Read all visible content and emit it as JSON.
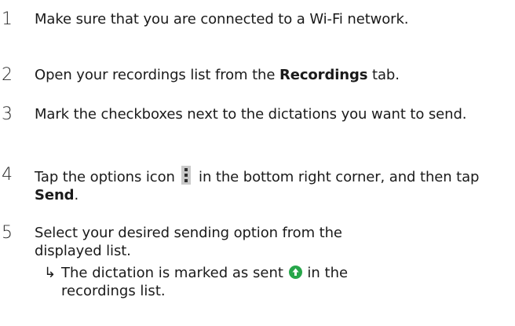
{
  "steps": [
    {
      "number": "1",
      "text": "Make sure that you are connected to a Wi-Fi network."
    },
    {
      "number": "2",
      "text_before": "Open your recordings list from the ",
      "bold": "Recordings",
      "text_after": " tab."
    },
    {
      "number": "3",
      "text": "Mark the checkboxes next to the dictations you want to send."
    },
    {
      "number": "4",
      "text_before": "Tap the options icon",
      "text_middle": "in the bottom right corner, and then tap ",
      "bold": "Send",
      "text_after": ".",
      "icon": "options-icon"
    },
    {
      "number": "5",
      "text": "Select your desired sending option from the displayed list.",
      "result": {
        "arrow": "↳",
        "text_before": "The dictation is marked as sent",
        "text_after": "in the recordings list.",
        "icon": "sent-upload-icon",
        "icon_color": "#27a64a"
      }
    }
  ]
}
